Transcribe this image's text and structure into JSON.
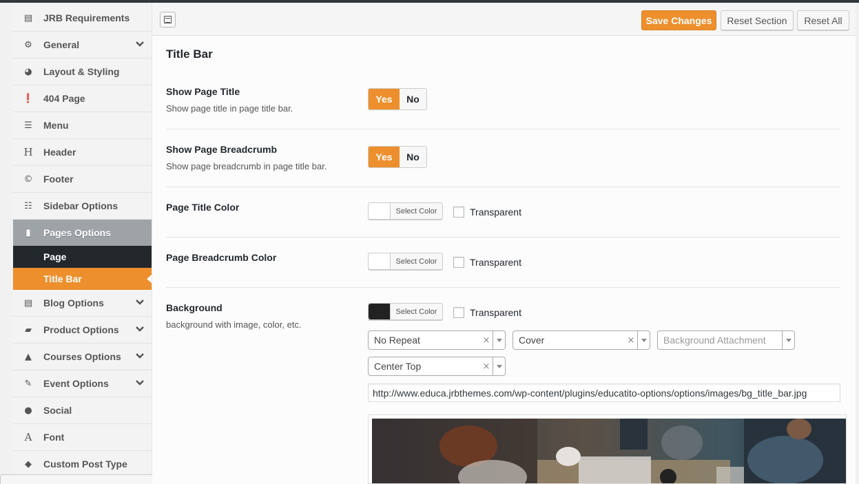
{
  "sidebar": {
    "items": [
      {
        "label": "JRB Requirements",
        "icon": "list-icon",
        "chevron": false
      },
      {
        "label": "General",
        "icon": "gears-icon",
        "chevron": true
      },
      {
        "label": "Layout & Styling",
        "icon": "dashboard-icon",
        "chevron": false
      },
      {
        "label": "404 Page",
        "icon": "exclamation-icon",
        "chevron": false
      },
      {
        "label": "Menu",
        "icon": "menu-icon",
        "chevron": false
      },
      {
        "label": "Header",
        "icon": "heading-icon",
        "chevron": false
      },
      {
        "label": "Footer",
        "icon": "copyright-icon",
        "chevron": false
      },
      {
        "label": "Sidebar Options",
        "icon": "list-view-icon",
        "chevron": false
      },
      {
        "label": "Pages Options",
        "icon": "page-icon",
        "chevron": false,
        "active": true
      },
      {
        "label": "Blog Options",
        "icon": "document-icon",
        "chevron": true
      },
      {
        "label": "Product Options",
        "icon": "briefcase-icon",
        "chevron": true
      },
      {
        "label": "Courses Options",
        "icon": "graduation-cap-icon",
        "chevron": true
      },
      {
        "label": "Event Options",
        "icon": "edit-icon",
        "chevron": true
      },
      {
        "label": "Social",
        "icon": "globe-icon",
        "chevron": false
      },
      {
        "label": "Font",
        "icon": "font-icon",
        "chevron": false
      },
      {
        "label": "Custom Post Type",
        "icon": "tags-icon",
        "chevron": false
      }
    ],
    "subitems": [
      {
        "label": "Page",
        "selected": false
      },
      {
        "label": "Title Bar",
        "selected": true
      }
    ]
  },
  "header": {
    "save_label": "Save Changes",
    "reset_section_label": "Reset Section",
    "reset_all_label": "Reset All"
  },
  "section": {
    "title": "Title Bar"
  },
  "fields": {
    "show_title": {
      "label": "Show Page Title",
      "desc": "Show page title in page title bar.",
      "yes": "Yes",
      "no": "No",
      "value": "Yes"
    },
    "show_breadcrumb": {
      "label": "Show Page Breadcrumb",
      "desc": "Show page breadcrumb in page title bar.",
      "yes": "Yes",
      "no": "No",
      "value": "Yes"
    },
    "title_color": {
      "label": "Page Title Color",
      "button": "Select Color",
      "transparent": "Transparent",
      "swatch": "#ffffff"
    },
    "breadcrumb_color": {
      "label": "Page Breadcrumb Color",
      "button": "Select Color",
      "transparent": "Transparent",
      "swatch": "#ffffff"
    },
    "background": {
      "label": "Background",
      "desc": "background with image, color, etc.",
      "button": "Select Color",
      "transparent": "Transparent",
      "swatch": "#222222",
      "repeat": "No Repeat",
      "size": "Cover",
      "attachment_placeholder": "Background Attachment",
      "position": "Center Top",
      "url": "http://www.educa.jrbthemes.com/wp-content/plugins/educatito-options/options/images/bg_title_bar.jpg"
    }
  },
  "colors": {
    "accent": "#ed8f2c",
    "sidebar_dark": "#23282d",
    "sidebar_active": "#9ea3a8"
  }
}
